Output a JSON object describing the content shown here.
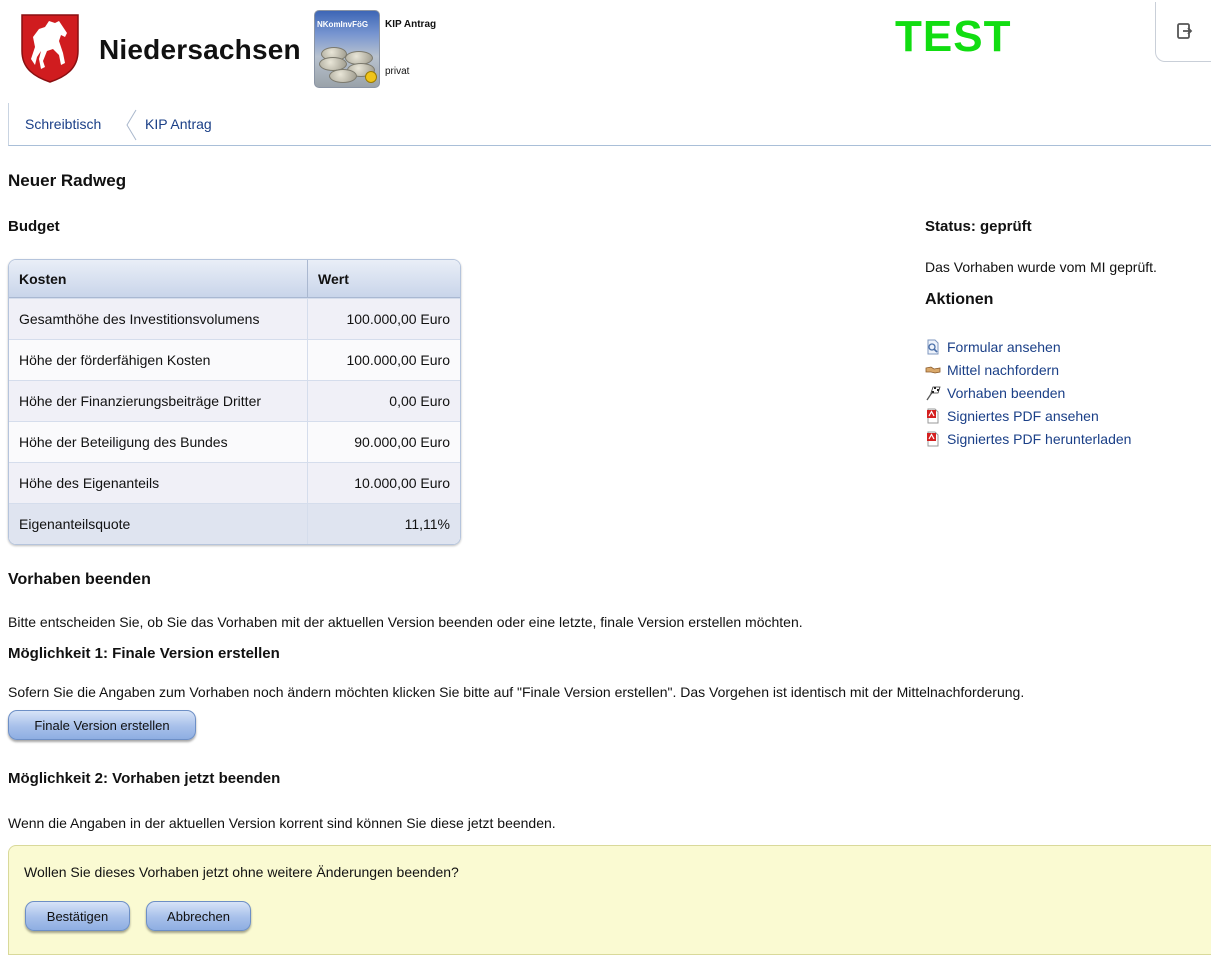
{
  "header": {
    "state_name": "Niedersachsen",
    "app_icon_label": "NKomInvFöG",
    "app_title": "KIP Antrag",
    "app_subtitle": "privat",
    "env_banner": "TEST",
    "env_banner_color": "#11dd11",
    "logout_icon": "logout-icon"
  },
  "breadcrumb": {
    "items": [
      {
        "label": "Schreibtisch"
      },
      {
        "label": "KIP Antrag"
      }
    ]
  },
  "page": {
    "title": "Neuer Radweg",
    "budget_heading": "Budget"
  },
  "budget_table": {
    "headers": {
      "cost": "Kosten",
      "value": "Wert"
    },
    "rows": [
      {
        "label": "Gesamthöhe des Investitionsvolumens",
        "value": "100.000,00 Euro"
      },
      {
        "label": "Höhe der förderfähigen Kosten",
        "value": "100.000,00 Euro"
      },
      {
        "label": "Höhe der Finanzierungsbeiträge Dritter",
        "value": "0,00 Euro"
      },
      {
        "label": "Höhe der Beteiligung des Bundes",
        "value": "90.000,00 Euro"
      },
      {
        "label": "Höhe des Eigenanteils",
        "value": "10.000,00 Euro"
      },
      {
        "label": "Eigenanteilsquote",
        "value": "11,11%"
      }
    ]
  },
  "status": {
    "title": "Status: geprüft",
    "text": "Das Vorhaben wurde vom MI geprüft."
  },
  "actions": {
    "title": "Aktionen",
    "items": [
      {
        "label": "Formular ansehen",
        "icon": "document-view-icon"
      },
      {
        "label": "Mittel nachfordern",
        "icon": "handshake-icon"
      },
      {
        "label": "Vorhaben beenden",
        "icon": "finish-flag-icon"
      },
      {
        "label": "Signiertes PDF ansehen",
        "icon": "pdf-icon"
      },
      {
        "label": "Signiertes PDF herunterladen",
        "icon": "pdf-icon"
      }
    ]
  },
  "finish": {
    "heading": "Vorhaben beenden",
    "intro": "Bitte entscheiden Sie, ob Sie das Vorhaben mit der aktuellen Version beenden oder eine letzte, finale Version erstellen möchten.",
    "option1": {
      "heading": "Möglichkeit 1: Finale Version erstellen",
      "text": "Sofern Sie die Angaben zum Vorhaben noch ändern möchten klicken Sie bitte auf \"Finale Version erstellen\". Das Vorgehen ist identisch mit der Mittelnachforderung.",
      "button": "Finale Version erstellen"
    },
    "option2": {
      "heading": "Möglichkeit 2: Vorhaben jetzt beenden",
      "text": "Wenn die Angaben in der aktuellen Version korrent sind können Sie diese jetzt beenden.",
      "confirm_question": "Wollen Sie dieses Vorhaben jetzt ohne weitere Änderungen beenden?",
      "confirm_button": "Bestätigen",
      "cancel_button": "Abbrechen"
    }
  }
}
